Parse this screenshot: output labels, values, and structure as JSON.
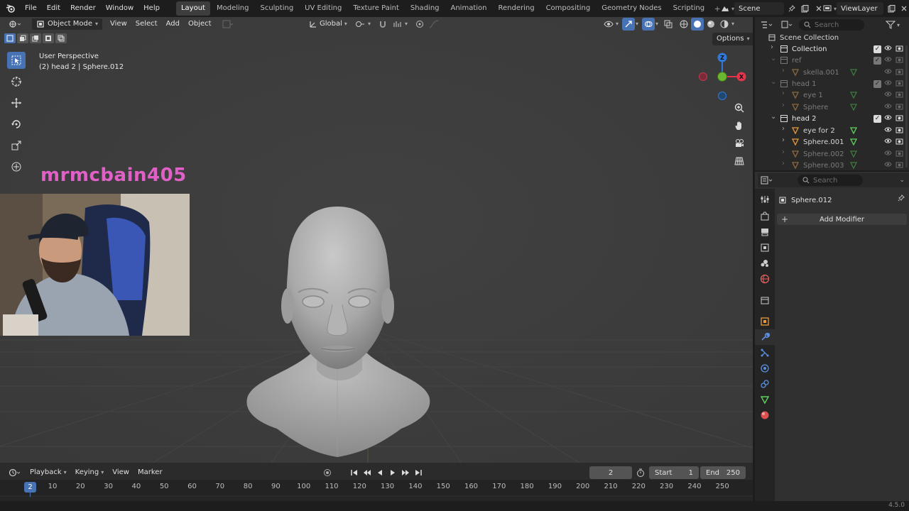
{
  "menus": [
    "File",
    "Edit",
    "Render",
    "Window",
    "Help"
  ],
  "workspaces": [
    {
      "label": "Layout",
      "active": true
    },
    {
      "label": "Modeling"
    },
    {
      "label": "Sculpting"
    },
    {
      "label": "UV Editing"
    },
    {
      "label": "Texture Paint"
    },
    {
      "label": "Shading"
    },
    {
      "label": "Animation"
    },
    {
      "label": "Rendering"
    },
    {
      "label": "Compositing"
    },
    {
      "label": "Geometry Nodes"
    },
    {
      "label": "Scripting"
    }
  ],
  "scene": "Scene",
  "view_layer": "ViewLayer",
  "viewport": {
    "mode": "Object Mode",
    "menus": [
      "View",
      "Select",
      "Add",
      "Object"
    ],
    "orientation": "Global",
    "options": "Options",
    "perspective": "User Perspective",
    "object_info": "(2) head 2 | Sphere.012"
  },
  "gizmo": {
    "z": "Z",
    "x": "X"
  },
  "streamer": "mrmcbain405",
  "outliner": {
    "search": "Search",
    "root": "Scene Collection",
    "rows": [
      {
        "label": "Collection",
        "level": 1,
        "type": "collection",
        "dim": false,
        "arrow": "›"
      },
      {
        "label": "ref",
        "level": 1,
        "type": "collection",
        "dim": true,
        "arrow": "⌄"
      },
      {
        "label": "skella.001",
        "level": 2,
        "type": "mesh",
        "dim": true,
        "arrow": "›"
      },
      {
        "label": "head 1",
        "level": 1,
        "type": "collection",
        "dim": true,
        "arrow": "⌄"
      },
      {
        "label": "eye 1",
        "level": 2,
        "type": "mesh",
        "dim": true,
        "arrow": "›"
      },
      {
        "label": "Sphere",
        "level": 2,
        "type": "mesh",
        "dim": true,
        "arrow": "›"
      },
      {
        "label": "head 2",
        "level": 1,
        "type": "collection",
        "dim": false,
        "arrow": "⌄"
      },
      {
        "label": "eye for 2",
        "level": 2,
        "type": "mesh",
        "dim": false,
        "arrow": "›"
      },
      {
        "label": "Sphere.001",
        "level": 2,
        "type": "mesh",
        "dim": false,
        "arrow": "›"
      },
      {
        "label": "Sphere.002",
        "level": 2,
        "type": "mesh",
        "dim": true,
        "arrow": "›"
      },
      {
        "label": "Sphere.003",
        "level": 2,
        "type": "mesh",
        "dim": true,
        "arrow": "›"
      }
    ]
  },
  "properties": {
    "search": "Search",
    "object": "Sphere.012",
    "add_modifier": "Add Modifier"
  },
  "timeline": {
    "menus": [
      "Playback",
      "Keying",
      "View",
      "Marker"
    ],
    "current_frame": "2",
    "start_label": "Start",
    "start": "1",
    "end_label": "End",
    "end": "250",
    "ticks": [
      "10",
      "20",
      "30",
      "40",
      "50",
      "60",
      "70",
      "80",
      "90",
      "100",
      "110",
      "120",
      "130",
      "140",
      "150",
      "160",
      "170",
      "180",
      "190",
      "200",
      "210",
      "220",
      "230",
      "240",
      "250"
    ]
  },
  "version": "4.5.0",
  "colors": {
    "accent": "#4772b3",
    "streamer": "#e060c8",
    "x_axis": "#e2354c",
    "y_axis": "#6ab832",
    "z_axis": "#2f7ad8"
  }
}
